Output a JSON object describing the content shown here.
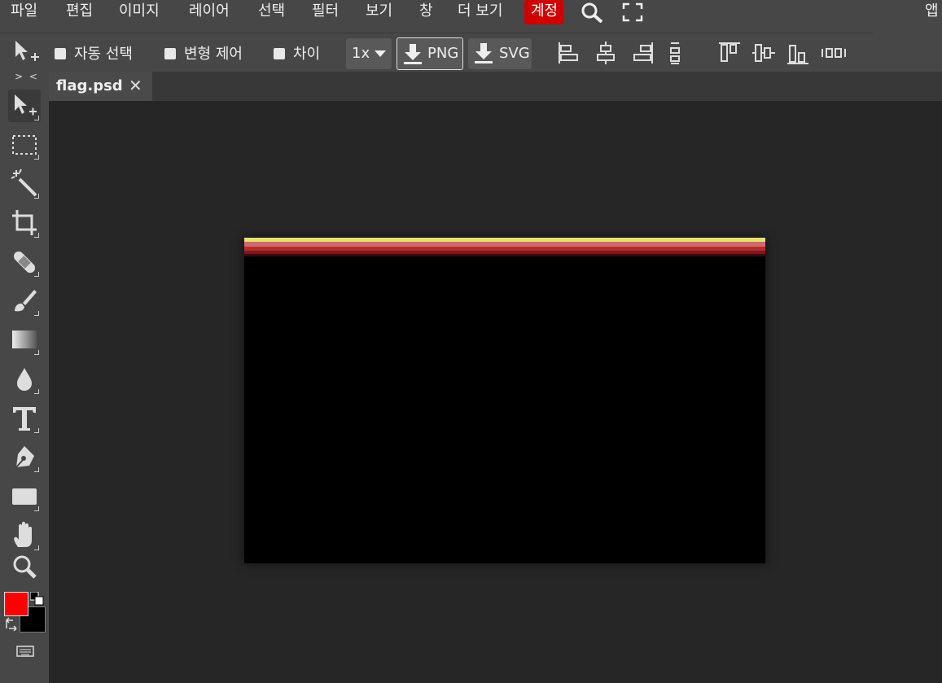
{
  "menu": {
    "items": [
      "파일",
      "편집",
      "이미지",
      "레이어",
      "선택",
      "필터",
      "보기",
      "창",
      "더 보기"
    ],
    "account": "계정",
    "apps": "앱"
  },
  "options": {
    "auto_select": "자동 선택",
    "transform_controls": "변형 제어",
    "distance": "차이",
    "zoom_value": "1x",
    "png_label": "PNG",
    "svg_label": "SVG"
  },
  "document": {
    "tab_title": "flag.psd",
    "close_glyph": "✕"
  },
  "toolbox": {
    "collapse_label": "> <",
    "foreground_color": "#ff0000",
    "background_color": "#000000"
  },
  "icons": [
    "move-icon",
    "search-icon",
    "fullscreen-icon",
    "download-icon",
    "align-left-icon",
    "align-center-icon",
    "align-right-icon",
    "distribute-icon"
  ]
}
